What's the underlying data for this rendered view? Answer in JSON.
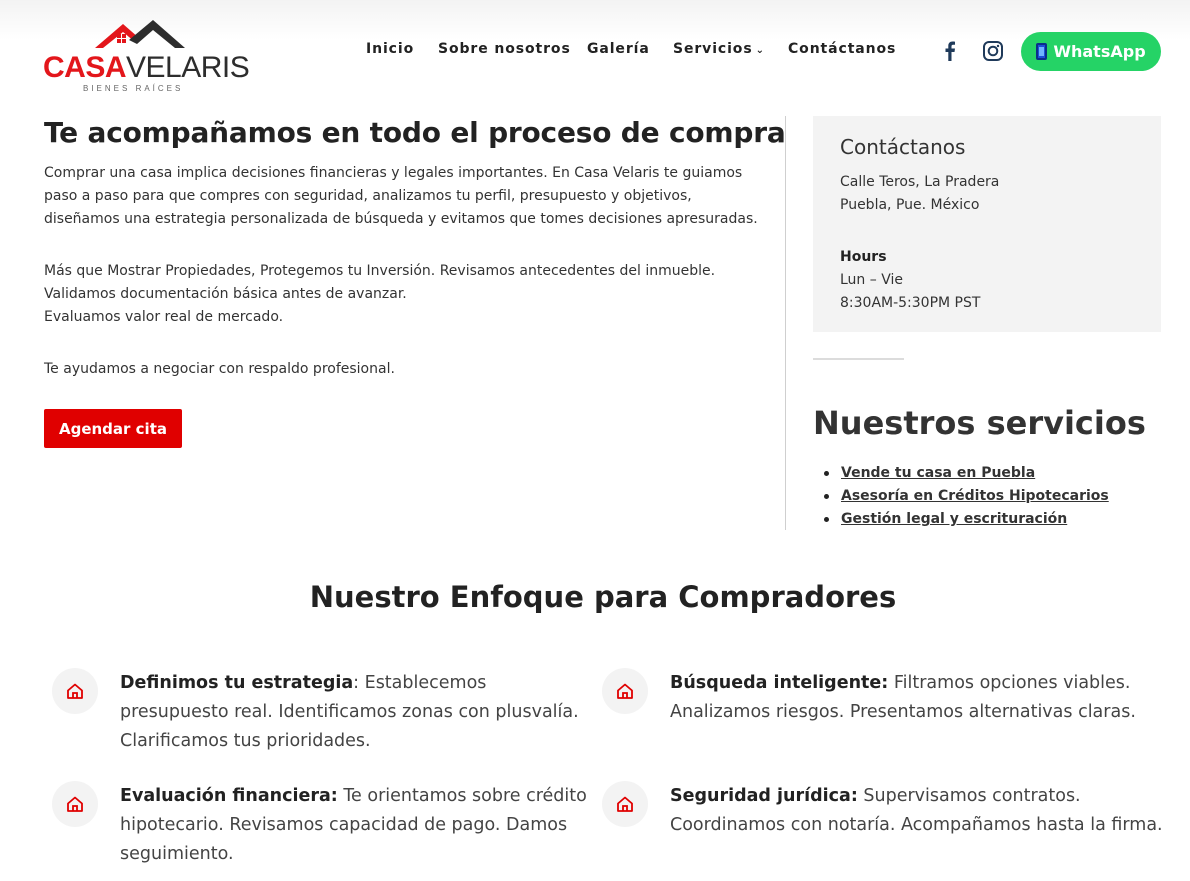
{
  "brand": {
    "name_part1": "CASA",
    "name_part2": "VELARIS",
    "tagline": "BIENES RAÍCES",
    "accent_color": "#e3161b"
  },
  "nav": {
    "items": [
      "Inicio",
      "Sobre nosotros",
      "Galería",
      "Servicios",
      "Contáctanos"
    ],
    "servicios_chevron": "⌄"
  },
  "social": {
    "facebook_icon": "facebook-icon",
    "instagram_icon": "instagram-icon"
  },
  "whatsapp": {
    "label": "WhatsApp",
    "color": "#25d366"
  },
  "main": {
    "title": "Te acompañamos en todo el proceso de compra",
    "para1": "Comprar una casa implica decisiones financieras y legales importantes. En Casa Velaris te guiamos paso a paso para que compres con seguridad, analizamos tu perfil, presupuesto y objetivos, diseñamos una estrategia personalizada de búsqueda y evitamos que tomes decisiones apresuradas.",
    "para2_lines": [
      "Más que Mostrar Propiedades, Protegemos tu Inversión. Revisamos antecedentes del inmueble.",
      "Validamos documentación básica antes de avanzar.",
      "Evaluamos valor real de mercado."
    ],
    "para3": "Te ayudamos a negociar con respaldo profesional.",
    "cta_label": "Agendar cita",
    "cta_color": "#e00000"
  },
  "sidebar": {
    "contact_title": "Contáctanos",
    "address_line1": "Calle Teros, La Pradera",
    "address_line2": "Puebla, Pue. México",
    "hours_label": "Hours",
    "hours_days": "Lun – Vie",
    "hours_time": "8:30AM-5:30PM PST",
    "services_title": "Nuestros servicios",
    "services": [
      "Vende tu casa en Puebla",
      "Asesoría en Créditos Hipotecarios",
      "Gestión legal y escrituración"
    ]
  },
  "approach": {
    "title": "Nuestro Enfoque para Compradores",
    "features": [
      {
        "bold": "Definimos tu estrategia",
        "text": ": Establecemos presupuesto real. Identificamos zonas con plusvalía. Clarificamos tus prioridades.",
        "icon": "home-icon"
      },
      {
        "bold": "Búsqueda inteligente:",
        "text": " Filtramos opciones viables. Analizamos riesgos. Presentamos alternativas claras.",
        "icon": "home-icon"
      },
      {
        "bold": "Evaluación financiera:",
        "text": " Te orientamos sobre crédito hipotecario. Revisamos capacidad de pago. Damos seguimiento.",
        "icon": "home-icon"
      },
      {
        "bold": "Seguridad jurídica:",
        "text": " Supervisamos contratos. Coordinamos con notaría. Acompañamos hasta la firma.",
        "icon": "home-icon"
      }
    ]
  }
}
